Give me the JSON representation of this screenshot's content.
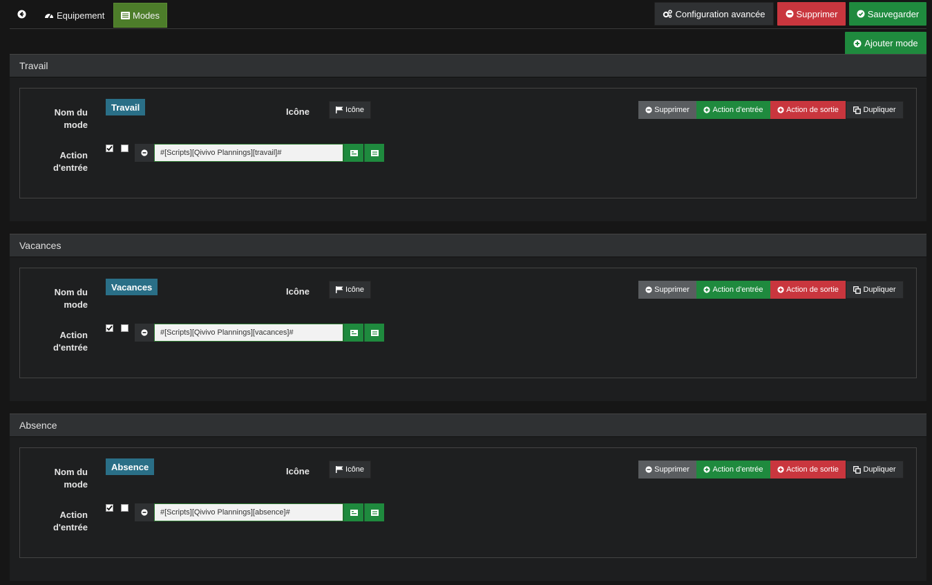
{
  "tabs": {
    "back_icon": "arrow-circle-left-icon",
    "equipement": "Equipement",
    "modes": "Modes"
  },
  "toolbar": {
    "config": "Configuration avancée",
    "delete": "Supprimer",
    "save": "Sauvegarder",
    "add_mode": "Ajouter mode"
  },
  "labels": {
    "mode_name_line1": "Nom du",
    "mode_name_line2": "mode",
    "action_line1": "Action",
    "action_line2": "d'entrée",
    "icon": "Icône",
    "icon_button": "Icône"
  },
  "actions": {
    "delete": "Supprimer",
    "entry": "Action d'entrée",
    "exit": "Action de sortie",
    "duplicate": "Dupliquer"
  },
  "colors": {
    "green": "#1f8a3e",
    "red": "#c9363e",
    "teal": "#2a6f87",
    "modes_tab": "#4d7d2a"
  },
  "modes": [
    {
      "title": "Travail",
      "name": "Travail",
      "command": "#[Scripts][Qivivo Plannings][travail]#",
      "enabled": true,
      "parallel": false
    },
    {
      "title": "Vacances",
      "name": "Vacances",
      "command": "#[Scripts][Qivivo Plannings][vacances]#",
      "enabled": true,
      "parallel": false
    },
    {
      "title": "Absence",
      "name": "Absence",
      "command": "#[Scripts][Qivivo Plannings][absence]#",
      "enabled": true,
      "parallel": false
    }
  ]
}
